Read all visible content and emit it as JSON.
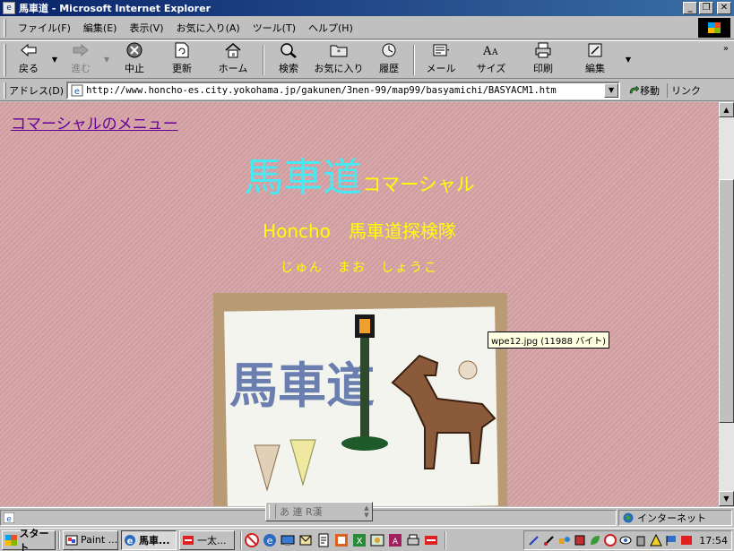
{
  "window": {
    "title": "馬車道 - Microsoft Internet Explorer"
  },
  "menu": [
    "ファイル(F)",
    "編集(E)",
    "表示(V)",
    "お気に入り(A)",
    "ツール(T)",
    "ヘルプ(H)"
  ],
  "toolbar": {
    "back": "戻る",
    "forward": "進む",
    "stop": "中止",
    "refresh": "更新",
    "home": "ホーム",
    "search": "検索",
    "favorites": "お気に入り",
    "history": "履歴",
    "mail": "メール",
    "size": "サイズ",
    "print": "印刷",
    "edit": "編集"
  },
  "address": {
    "label": "アドレス(D)",
    "url": "http://www.honcho-es.city.yokohama.jp/gakunen/3nen-99/map99/basyamichi/BASYACM1.htm",
    "go": "移動",
    "links": "リンク"
  },
  "page": {
    "menu_link": "コマーシャルのメニュー",
    "title_big": "馬車道",
    "title_small": "コマーシャル",
    "subtitle": "Honcho　馬車道探検隊",
    "names": "じゅん　まお　しょうこ",
    "photo_text": "馬車道",
    "tooltip": "wpe12.jpg (11988 バイト)"
  },
  "status": {
    "zone": "インターネット"
  },
  "ime": {
    "label": "あ 連 R漢"
  },
  "taskbar": {
    "start": "スタート",
    "tasks": [
      {
        "label": "Paint ..."
      },
      {
        "label": "馬車..."
      },
      {
        "label": "一太..."
      }
    ],
    "clock": "17:54"
  },
  "colors": {
    "page_bg": "#d6a3a6",
    "cyan": "#44eaf4",
    "yellow": "#ffff00",
    "link": "#660099"
  }
}
